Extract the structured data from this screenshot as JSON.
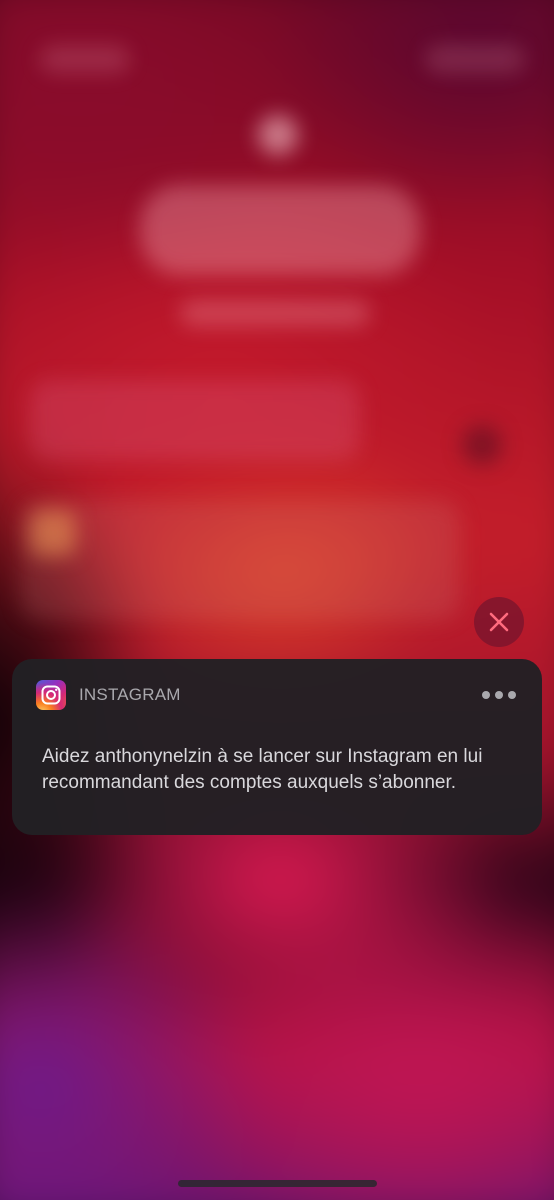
{
  "notification": {
    "app_name": "INSTAGRAM",
    "app_icon": "instagram-icon",
    "message": "Aidez anthonynelzin à se lancer sur Instagram en lui recommandant des comptes auxquels s’abonner.",
    "more_icon": "ellipsis-icon"
  },
  "clear_button": {
    "icon": "close-icon",
    "color": "#ff6b7e"
  },
  "colors": {
    "card_background": "#222024",
    "app_name_text": "#a9a8ad",
    "body_text": "#d9d8dc"
  }
}
